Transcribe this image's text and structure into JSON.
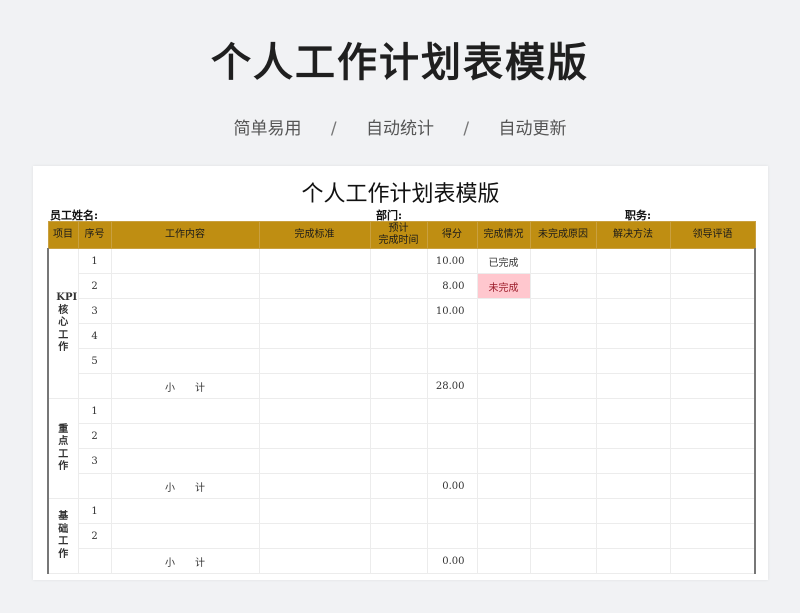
{
  "banner": {
    "title": "个人工作计划表模版",
    "tags": [
      "简单易用",
      "自动统计",
      "自动更新"
    ],
    "separator": "/"
  },
  "sheet": {
    "title": "个人工作计划表模版",
    "employee_label": "员工姓名:",
    "dept_label": "部门:",
    "position_label": "职务:"
  },
  "columns": [
    "项目",
    "序号",
    "工作内容",
    "完成标准",
    "预计\n完成时间",
    "得分",
    "完成情况",
    "未完成原因",
    "解决方法",
    "领导评语"
  ],
  "groups": [
    {
      "name": "KPI核心工作",
      "rows": [
        {
          "no": "1",
          "score": "10.00",
          "status": "已完成"
        },
        {
          "no": "2",
          "score": "8.00",
          "status": "未完成"
        },
        {
          "no": "3",
          "score": "10.00",
          "status": ""
        },
        {
          "no": "4",
          "score": "",
          "status": ""
        },
        {
          "no": "5",
          "score": "",
          "status": ""
        }
      ],
      "subtotal_label": "小　　计",
      "subtotal": "28.00"
    },
    {
      "name": "重点工作",
      "rows": [
        {
          "no": "1",
          "score": "",
          "status": ""
        },
        {
          "no": "2",
          "score": "",
          "status": ""
        },
        {
          "no": "3",
          "score": "",
          "status": ""
        }
      ],
      "subtotal_label": "小　　计",
      "subtotal": "0.00"
    },
    {
      "name": "基础工作",
      "rows": [
        {
          "no": "1",
          "score": "",
          "status": ""
        },
        {
          "no": "2",
          "score": "",
          "status": ""
        }
      ],
      "subtotal_label": "小　　计",
      "subtotal": "0.00"
    }
  ],
  "colors": {
    "header_bg": "#bf8e12",
    "incomplete_bg": "#ffc7ce",
    "incomplete_text": "#9c1c2a"
  }
}
